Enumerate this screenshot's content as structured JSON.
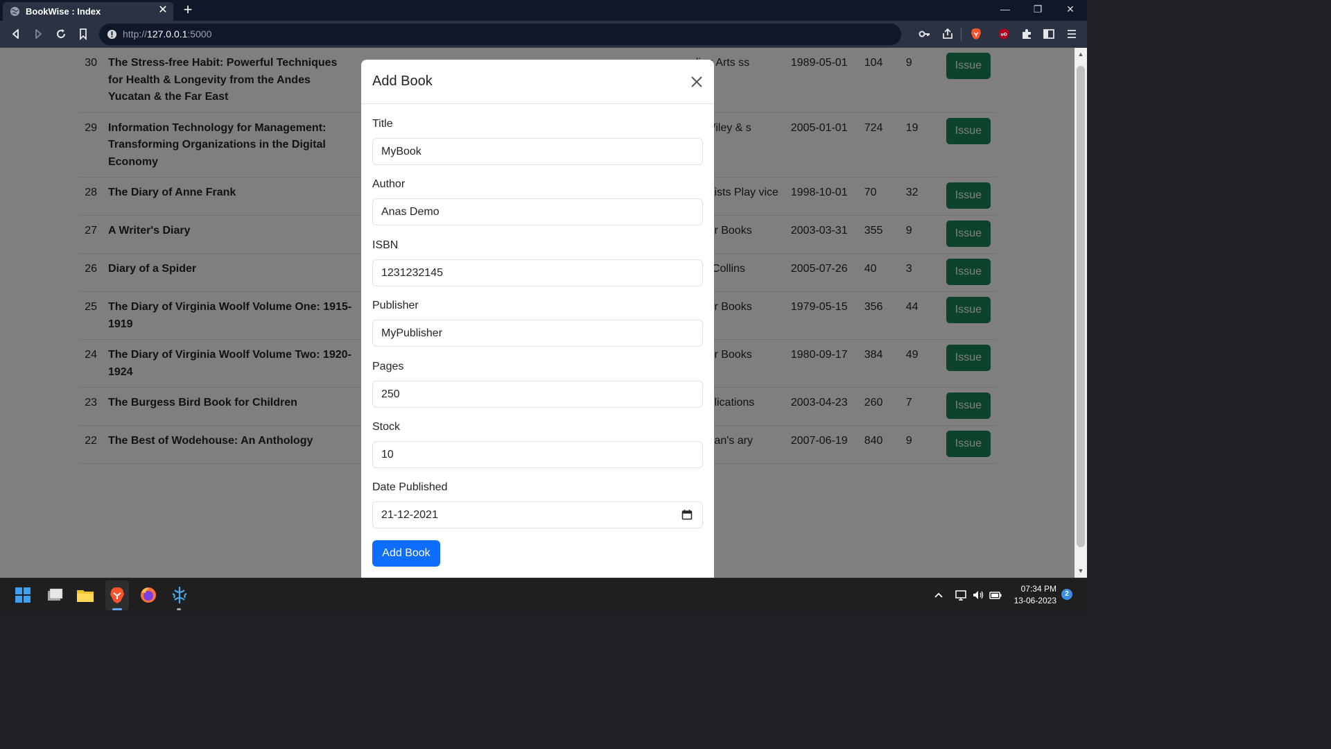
{
  "browser": {
    "tab_title": "BookWise : Index",
    "url_host": "http://",
    "url_main": "127.0.0.1",
    "url_port": ":5000"
  },
  "table": {
    "rows": [
      {
        "id": "30",
        "title": "The Stress-free Habit: Powerful Techniques for Health & Longevity from the Andes Yucatan & the Far East",
        "author": "",
        "isbn": "",
        "publisher": "ling Arts ss",
        "date": "1989-05-01",
        "pages": "104",
        "stock": "9",
        "action": "Issue"
      },
      {
        "id": "29",
        "title": "Information Technology for Management: Transforming Organizations in the Digital Economy",
        "author": "",
        "isbn": "",
        "publisher": "n Wiley & s",
        "date": "2005-01-01",
        "pages": "724",
        "stock": "19",
        "action": "Issue"
      },
      {
        "id": "28",
        "title": "The Diary of Anne Frank",
        "author": "",
        "isbn": "",
        "publisher": "matists Play vice",
        "date": "1998-10-01",
        "pages": "70",
        "stock": "32",
        "action": "Issue"
      },
      {
        "id": "27",
        "title": "A Writer's Diary",
        "author": "",
        "isbn": "",
        "publisher": "riner Books",
        "date": "2003-03-31",
        "pages": "355",
        "stock": "9",
        "action": "Issue"
      },
      {
        "id": "26",
        "title": "Diary of a Spider",
        "author": "",
        "isbn": "",
        "publisher": "perCollins",
        "date": "2005-07-26",
        "pages": "40",
        "stock": "3",
        "action": "Issue"
      },
      {
        "id": "25",
        "title": "The Diary of Virginia Woolf Volume One: 1915-1919",
        "author": "",
        "isbn": "",
        "publisher": "riner Books",
        "date": "1979-05-15",
        "pages": "356",
        "stock": "44",
        "action": "Issue"
      },
      {
        "id": "24",
        "title": "The Diary of Virginia Woolf Volume Two: 1920-1924",
        "author": "",
        "isbn": "",
        "publisher": "riner Books",
        "date": "1980-09-17",
        "pages": "384",
        "stock": "49",
        "action": "Issue"
      },
      {
        "id": "23",
        "title": "The Burgess Bird Book for Children",
        "author": "",
        "isbn": "",
        "publisher": "ver lications",
        "date": "2003-04-23",
        "pages": "260",
        "stock": "7",
        "action": "Issue"
      },
      {
        "id": "22",
        "title": "The Best of Wodehouse: An Anthology",
        "author": "",
        "isbn": "",
        "publisher": "ryman's ary",
        "date": "2007-06-19",
        "pages": "840",
        "stock": "9",
        "action": "Issue"
      }
    ]
  },
  "modal": {
    "title": "Add Book",
    "fields": [
      {
        "label": "Title",
        "value": "MyBook"
      },
      {
        "label": "Author",
        "value": "Anas Demo"
      },
      {
        "label": "ISBN",
        "value": "1231232145"
      },
      {
        "label": "Publisher",
        "value": "MyPublisher"
      },
      {
        "label": "Pages",
        "value": "250"
      },
      {
        "label": "Stock",
        "value": "10"
      },
      {
        "label": "Date Published",
        "value": "21-12-2021"
      }
    ],
    "submit_label": "Add Book"
  },
  "taskbar": {
    "time": "07:34 PM",
    "date": "13-06-2023",
    "notification_count": "2"
  },
  "colors": {
    "issue_button": "#198754",
    "primary_button": "#0d6efd",
    "browser_bg": "#2b3243"
  }
}
